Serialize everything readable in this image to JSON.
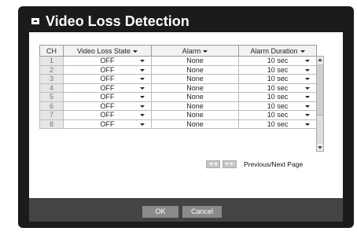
{
  "window": {
    "title": "Video Loss Detection"
  },
  "table": {
    "headers": {
      "ch": "CH",
      "state": "Video Loss State",
      "alarm": "Alarm",
      "duration": "Alarm Duration"
    },
    "rows": [
      {
        "ch": "1",
        "state": "OFF",
        "alarm": "None",
        "duration": "10 sec"
      },
      {
        "ch": "2",
        "state": "OFF",
        "alarm": "None",
        "duration": "10 sec"
      },
      {
        "ch": "3",
        "state": "OFF",
        "alarm": "None",
        "duration": "10 sec"
      },
      {
        "ch": "4",
        "state": "OFF",
        "alarm": "None",
        "duration": "10 sec"
      },
      {
        "ch": "5",
        "state": "OFF",
        "alarm": "None",
        "duration": "10 sec"
      },
      {
        "ch": "6",
        "state": "OFF",
        "alarm": "None",
        "duration": "10 sec"
      },
      {
        "ch": "7",
        "state": "OFF",
        "alarm": "None",
        "duration": "10 sec"
      },
      {
        "ch": "8",
        "state": "OFF",
        "alarm": "None",
        "duration": "10 sec"
      }
    ]
  },
  "pager": {
    "prev_glyph": "◄◄",
    "next_glyph": "►►",
    "label": "Previous/Next Page"
  },
  "buttons": {
    "ok": "OK",
    "cancel": "Cancel"
  },
  "colors": {
    "frame": "#1b1b1b",
    "footer": "#444444",
    "button": "#8a8a8a"
  }
}
